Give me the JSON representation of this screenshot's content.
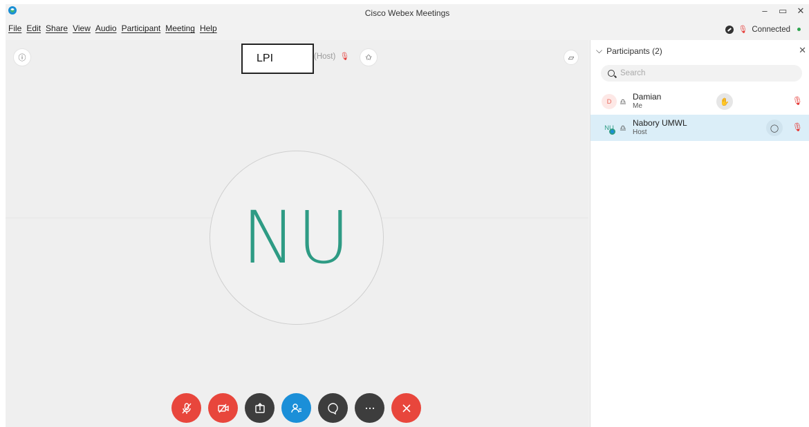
{
  "window": {
    "title": "Cisco Webex Meetings",
    "controls": [
      "–",
      "▭",
      "✕"
    ]
  },
  "menu": [
    "File",
    "Edit",
    "Share",
    "View",
    "Audio",
    "Participant",
    "Meeting",
    "Help"
  ],
  "status": {
    "text": "Connected",
    "dot_color": "#2ea44f"
  },
  "stage": {
    "host_label": "(Host)",
    "overlay_label": "LPI",
    "avatar_initials": "NU",
    "avatar_color": "#2e9b84"
  },
  "controls": [
    {
      "name": "mute",
      "color": "#e8463c"
    },
    {
      "name": "stop-video",
      "color": "#e8463c"
    },
    {
      "name": "share",
      "color": "#3d3d3d"
    },
    {
      "name": "participants",
      "color": "#1b8fd8"
    },
    {
      "name": "chat",
      "color": "#3d3d3d"
    },
    {
      "name": "more",
      "color": "#3d3d3d"
    },
    {
      "name": "leave",
      "color": "#e8463c"
    }
  ],
  "panel": {
    "title": "Participants (2)",
    "search_placeholder": "Search",
    "participants": [
      {
        "initials": "D",
        "name": "Damian",
        "role": "Me",
        "action_icon": "hand-icon"
      },
      {
        "initials": "NU",
        "name": "Nabory UMWL",
        "role": "Host",
        "action_icon": "chat-icon"
      }
    ]
  }
}
